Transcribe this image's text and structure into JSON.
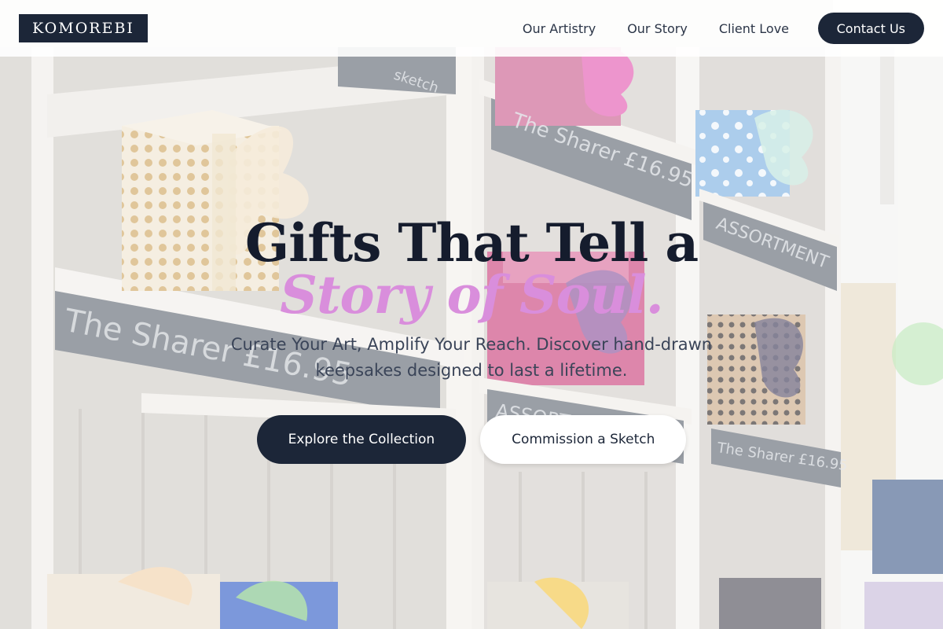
{
  "brand": {
    "logo_text": "KOMOREBI"
  },
  "nav": {
    "links": [
      {
        "label": "Our Artistry"
      },
      {
        "label": "Our Story"
      },
      {
        "label": "Client Love"
      }
    ],
    "contact_label": "Contact Us"
  },
  "hero": {
    "heading_line1": "Gifts That Tell a",
    "heading_line2": "Story of Soul.",
    "subtitle": "Curate Your Art, Amplify Your Reach. Discover hand-drawn keepsakes designed to last a lifetime.",
    "primary_cta": "Explore the Collection",
    "secondary_cta": "Commission a Sketch",
    "background_image": "gift-shelves-photo",
    "shelf_labels": {
      "sharer": "The Sharer £16.95",
      "assortment": "ASSORTMENT",
      "sketch": "sketch"
    }
  },
  "colors": {
    "navy": "#1c2638",
    "accent_pink": "#d98edc",
    "heading": "#151c2d",
    "body_text": "#3a4458"
  }
}
